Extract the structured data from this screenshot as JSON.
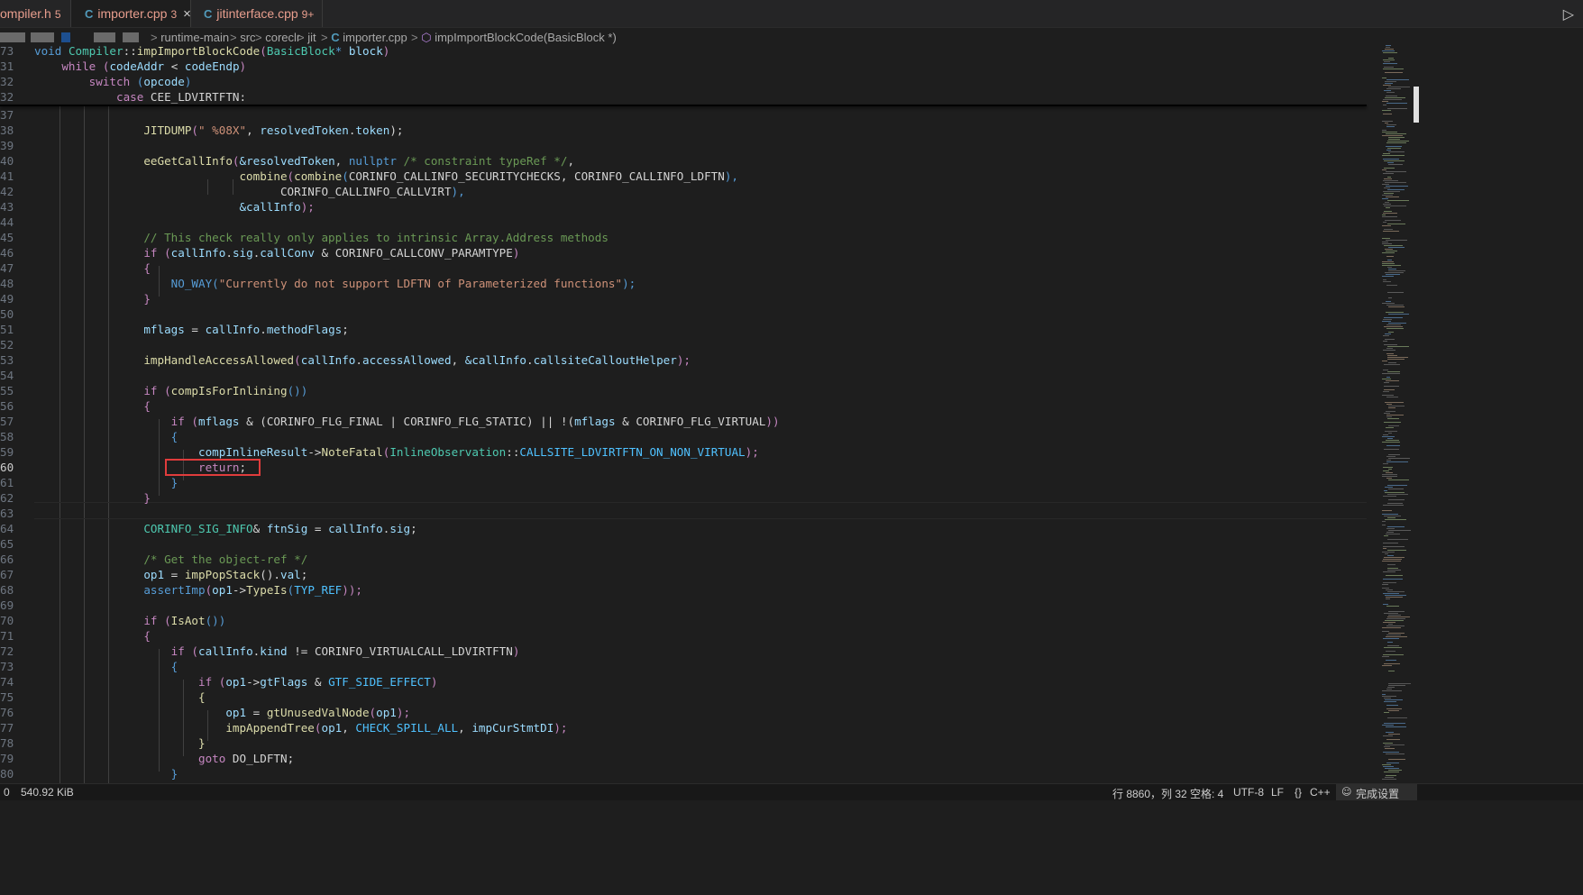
{
  "tabs": [
    {
      "label": "ompiler.h",
      "count": "5",
      "active": false
    },
    {
      "label": "importer.cpp",
      "count": "3",
      "active": true,
      "close": "×"
    },
    {
      "label": "jitinterface.cpp",
      "count": "9+",
      "active": false
    }
  ],
  "tab_icon_glyph": "C",
  "breadcrumb": {
    "sep": ">",
    "items": [
      "runtime-main",
      "src",
      "coreclr",
      "jit",
      "importer.cpp",
      "impImportBlockCode(BasicBlock *)"
    ]
  },
  "sticky": {
    "ln": [
      "73",
      "31",
      "32",
      "32"
    ],
    "l0": {
      "kw": "void",
      "cls": "Compiler",
      "sep": "::",
      "fn": "impImportBlockCode",
      "p1": "(",
      "ty": "BasicBlock",
      "star": "*",
      "par": "block",
      "p2": ")"
    },
    "l1": {
      "kw": "while",
      "p1": "(",
      "a": "codeAddr",
      "op": " < ",
      "b": "codeEndp",
      "p2": ")"
    },
    "l2": {
      "kw": "switch",
      "p1": "(",
      "a": "opcode",
      "p2": ")"
    },
    "l3": {
      "kw": "case",
      "rest": " CEE_LDVIRTFTN:"
    }
  },
  "lines": {
    "37": "",
    "38": {
      "fn": "JITDUMP",
      "p1": "(",
      "str": "\" %08X\"",
      "c": ", ",
      "a": "resolvedToken",
      "d": ".",
      "b": "token",
      "p2": ");"
    },
    "39": "",
    "40": {
      "fn": "eeGetCallInfo",
      "p1": "(",
      "a": "&resolvedToken",
      "c": ", ",
      "kw": "nullptr",
      "cm": " /* constraint typeRef */",
      "end": ","
    },
    "41": {
      "fn1": "combine",
      "p1": "(",
      "fn2": "combine",
      "p2": "(",
      "a": "CORINFO_CALLINFO_SECURITYCHECKS",
      "c": ", ",
      "b": "CORINFO_CALLINFO_LDFTN",
      "p3": "),"
    },
    "42": {
      "a": "CORINFO_CALLINFO_CALLVIRT",
      "p": "),"
    },
    "43": {
      "a": "&callInfo",
      "p": ");"
    },
    "44": "",
    "45": {
      "cm": "// This check really only applies to intrinsic Array.Address methods"
    },
    "46": {
      "kw": "if",
      "p1": " (",
      "a": "callInfo",
      "d1": ".",
      "b": "sig",
      "d2": ".",
      "c": "callConv",
      "op": " & ",
      "e": "CORINFO_CALLCONV_PARAMTYPE",
      "p2": ")"
    },
    "47": {
      "t": "{"
    },
    "48": {
      "mac": "NO_WAY",
      "p1": "(",
      "str": "\"Currently do not support LDFTN of Parameterized functions\"",
      "p2": ");"
    },
    "49": {
      "t": "}"
    },
    "50": "",
    "51": {
      "a": "mflags",
      "op": " = ",
      "b": "callInfo",
      "d": ".",
      "c": "methodFlags",
      "end": ";"
    },
    "52": "",
    "53": {
      "fn": "impHandleAccessAllowed",
      "p1": "(",
      "a": "callInfo",
      "d1": ".",
      "b": "accessAllowed",
      "c": ", ",
      "e": "&callInfo",
      "d2": ".",
      "f": "callsiteCalloutHelper",
      "p2": ");"
    },
    "54": "",
    "55": {
      "kw": "if",
      "p1": " (",
      "fn": "compIsForInlining",
      "p2": "())"
    },
    "56": {
      "t": "{"
    },
    "57": {
      "kw": "if",
      "p1": " (",
      "a": "mflags",
      "op1": " & (",
      "b": "CORINFO_FLG_FINAL",
      "op2": " | ",
      "c": "CORINFO_FLG_STATIC",
      "op3": ") || !(",
      "e": "mflags",
      "op4": " & ",
      "f": "CORINFO_FLG_VIRTUAL",
      "p2": "))"
    },
    "58": {
      "t": "{"
    },
    "59": {
      "a": "compInlineResult",
      "ar": "->",
      "fn": "NoteFatal",
      "p1": "(",
      "ty": "InlineObservation",
      "sep": "::",
      "en": "CALLSITE_LDVIRTFTN_ON_NON_VIRTUAL",
      "p2": ");"
    },
    "60": {
      "kw": "return",
      "end": ";"
    },
    "61": {
      "t": "}"
    },
    "62": {
      "t": "}"
    },
    "63": "",
    "64": {
      "ty": "CORINFO_SIG_INFO",
      "amp": "& ",
      "a": "ftnSig",
      "op": " = ",
      "b": "callInfo",
      "d": ".",
      "c": "sig",
      "end": ";"
    },
    "65": "",
    "66": {
      "cm": "/* Get the object-ref */"
    },
    "67": {
      "a": "op1",
      "op": " = ",
      "fn": "impPopStack",
      "p": "().",
      "b": "val",
      "end": ";"
    },
    "68": {
      "mac": "assertImp",
      "p1": "(",
      "a": "op1",
      "ar": "->",
      "fn": "TypeIs",
      "p2": "(",
      "en": "TYP_REF",
      "p3": "));"
    },
    "69": "",
    "70": {
      "kw": "if",
      "p1": " (",
      "fn": "IsAot",
      "p2": "())"
    },
    "71": {
      "t": "{"
    },
    "72": {
      "kw": "if",
      "p1": " (",
      "a": "callInfo",
      "d": ".",
      "b": "kind",
      "op": " != ",
      "c": "CORINFO_VIRTUALCALL_LDVIRTFTN",
      "p2": ")"
    },
    "73": {
      "t": "{"
    },
    "74": {
      "kw": "if",
      "p1": " (",
      "a": "op1",
      "ar": "->",
      "b": "gtFlags",
      "op": " & ",
      "en": "GTF_SIDE_EFFECT",
      "p2": ")"
    },
    "75": {
      "t": "{"
    },
    "76": {
      "a": "op1",
      "op": " = ",
      "fn": "gtUnusedValNode",
      "p1": "(",
      "b": "op1",
      "p2": ");"
    },
    "77": {
      "fn": "impAppendTree",
      "p1": "(",
      "a": "op1",
      "c": ", ",
      "en": "CHECK_SPILL_ALL",
      "c2": ", ",
      "b": "impCurStmtDI",
      "p2": ");"
    },
    "78": {
      "t": "}"
    },
    "79": {
      "kw": "goto",
      "rest": " DO_LDFTN;"
    },
    "80": {
      "t": "}"
    }
  },
  "status": {
    "left0": "0",
    "size": "540.92 KiB",
    "position": "行 8860，列 32",
    "indent": "空格: 4",
    "encoding": "UTF-8",
    "eol": "LF",
    "lang_icon": "{}",
    "lang": "C++",
    "complete": "完成设置"
  }
}
